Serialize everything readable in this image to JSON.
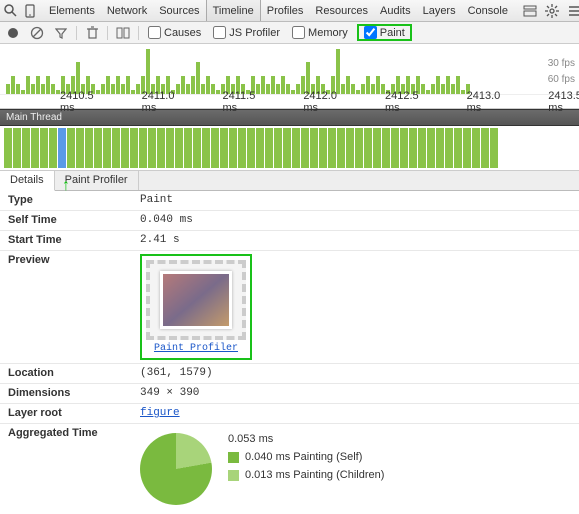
{
  "header": {
    "tabs": [
      "Elements",
      "Network",
      "Sources",
      "Timeline",
      "Profiles",
      "Resources",
      "Audits",
      "Layers",
      "Console"
    ],
    "active_tab": "Timeline"
  },
  "toolbar": {
    "checkboxes": {
      "causes": "Causes",
      "js_profiler": "JS Profiler",
      "memory": "Memory",
      "paint": "Paint"
    }
  },
  "fps": {
    "line1": "30 fps",
    "line2": "60 fps"
  },
  "ruler": [
    "2410.5 ms",
    "2411.0 ms",
    "2411.5 ms",
    "2412.0 ms",
    "2412.5 ms",
    "2413.0 ms",
    "2413.5 ms"
  ],
  "mainthread_title": "Main Thread",
  "tabs2": {
    "details": "Details",
    "paint_profiler": "Paint Profiler",
    "active": "Details"
  },
  "details": {
    "type_k": "Type",
    "type_v": "Paint",
    "self_k": "Self Time",
    "self_v": "0.040 ms",
    "start_k": "Start Time",
    "start_v": "2.41 s",
    "preview_k": "Preview",
    "preview_link": "Paint Profiler",
    "loc_k": "Location",
    "loc_v": "(361, 1579)",
    "dim_k": "Dimensions",
    "dim_v": "349 × 390",
    "layer_k": "Layer root",
    "layer_v": "figure",
    "agg_k": "Aggregated Time"
  },
  "chart_data": {
    "type": "pie",
    "title": "Aggregated Time",
    "total_label": "0.053 ms",
    "series": [
      {
        "name": "Painting (Self)",
        "value": 0.04,
        "label": "0.040 ms Painting (Self)",
        "color": "#7aba3f"
      },
      {
        "name": "Painting (Children)",
        "value": 0.013,
        "label": "0.013 ms Painting (Children)",
        "color": "#a8d47a"
      }
    ]
  }
}
